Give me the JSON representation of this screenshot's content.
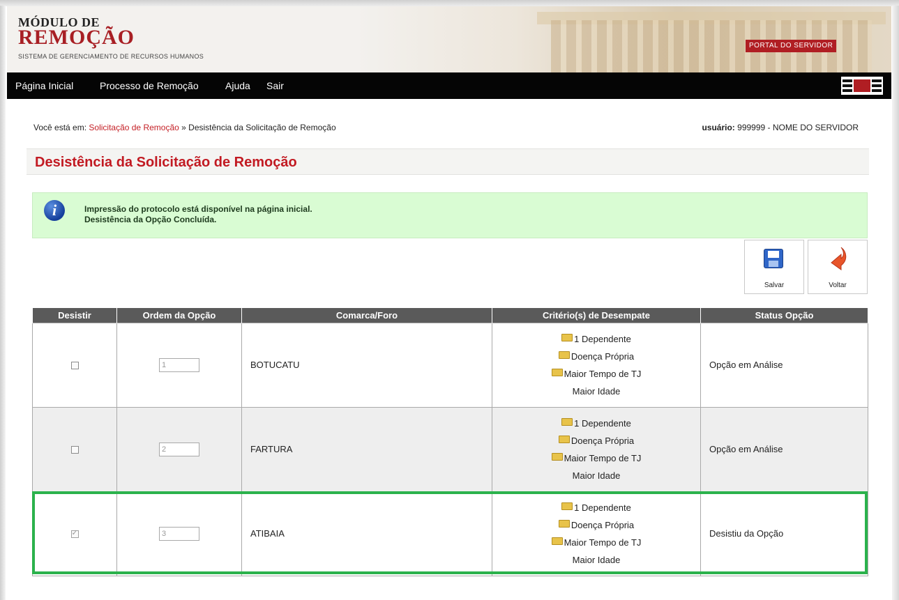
{
  "header": {
    "logo_line1": "MÓDULO DE",
    "logo_line2": "REMOÇÃO",
    "logo_subtitle": "SISTEMA DE GERENCIAMENTO DE RECURSOS HUMANOS",
    "portal_link": "PORTAL DO SERVIDOR"
  },
  "menu": {
    "items": [
      "Página Inicial",
      "Processo de Remoção",
      "Ajuda",
      "Sair"
    ]
  },
  "breadcrumb": {
    "prefix": "Você está em:",
    "link": "Solicitação de Remoção",
    "separator": "»",
    "current": "Desistência da Solicitação de Remoção"
  },
  "user": {
    "label": "usuário:",
    "value": "999999 - NOME DO SERVIDOR"
  },
  "page_title": "Desistência da Solicitação de Remoção",
  "info_message": {
    "line1": "Impressão do protocolo está disponível na página inicial.",
    "line2": "Desistência da Opção Concluída."
  },
  "actions": {
    "save_label": "Salvar",
    "back_label": "Voltar"
  },
  "table": {
    "headers": [
      "Desistir",
      "Ordem da Opção",
      "Comarca/Foro",
      "Critério(s) de Desempate",
      "Status Opção"
    ],
    "rows": [
      {
        "checked": false,
        "order": "1",
        "comarca": "BOTUCATU",
        "criteria": [
          "1 Dependente",
          "Doença Própria",
          "Maior Tempo de TJ",
          "Maior Idade"
        ],
        "status": "Opção em Análise"
      },
      {
        "checked": false,
        "order": "2",
        "comarca": "FARTURA",
        "criteria": [
          "1 Dependente",
          "Doença Própria",
          "Maior Tempo de TJ",
          "Maior Idade"
        ],
        "status": "Opção em Análise"
      },
      {
        "checked": true,
        "order": "3",
        "comarca": "ATIBAIA",
        "criteria": [
          "1 Dependente",
          "Doença Própria",
          "Maior Tempo de TJ",
          "Maior Idade"
        ],
        "status": "Desistiu da Opção"
      }
    ]
  },
  "colors": {
    "brand_red": "#c21a22",
    "info_bg": "#d9fcd3",
    "highlight_green": "#2bb24c",
    "menubar_bg": "#050505",
    "table_header_bg": "#5a5a5a"
  }
}
